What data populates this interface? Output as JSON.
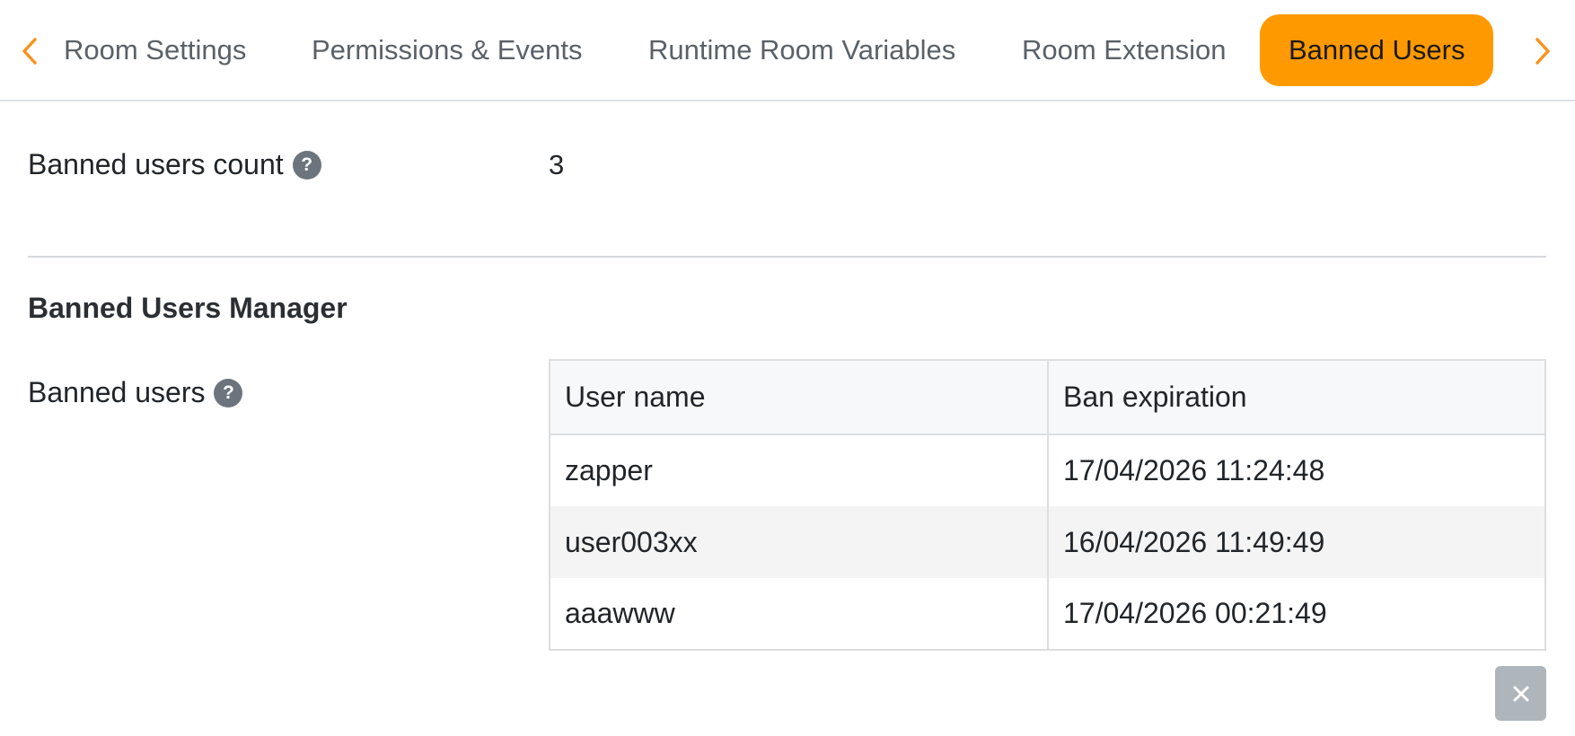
{
  "tabs": {
    "prev_icon": "chevron-left-icon",
    "next_icon": "chevron-right-icon",
    "items": [
      {
        "label": "Room Settings"
      },
      {
        "label": "Permissions & Events"
      },
      {
        "label": "Runtime Room Variables"
      },
      {
        "label": "Room Extension"
      },
      {
        "label": "Banned Users",
        "active": true
      }
    ],
    "accent_color": "#ff9900"
  },
  "banned_count": {
    "label": "Banned users count",
    "help_icon": "question-circle-icon",
    "value": "3"
  },
  "manager": {
    "title": "Banned Users Manager",
    "list_label": "Banned users",
    "help_icon": "question-circle-icon",
    "columns": [
      "User name",
      "Ban expiration"
    ],
    "rows": [
      {
        "user_name": "zapper",
        "ban_expiration": "17/04/2026 11:24:48"
      },
      {
        "user_name": "user003xx",
        "ban_expiration": "16/04/2026 11:49:49"
      },
      {
        "user_name": "aaawww",
        "ban_expiration": "17/04/2026 00:21:49"
      }
    ],
    "remove_icon": "close-icon"
  }
}
